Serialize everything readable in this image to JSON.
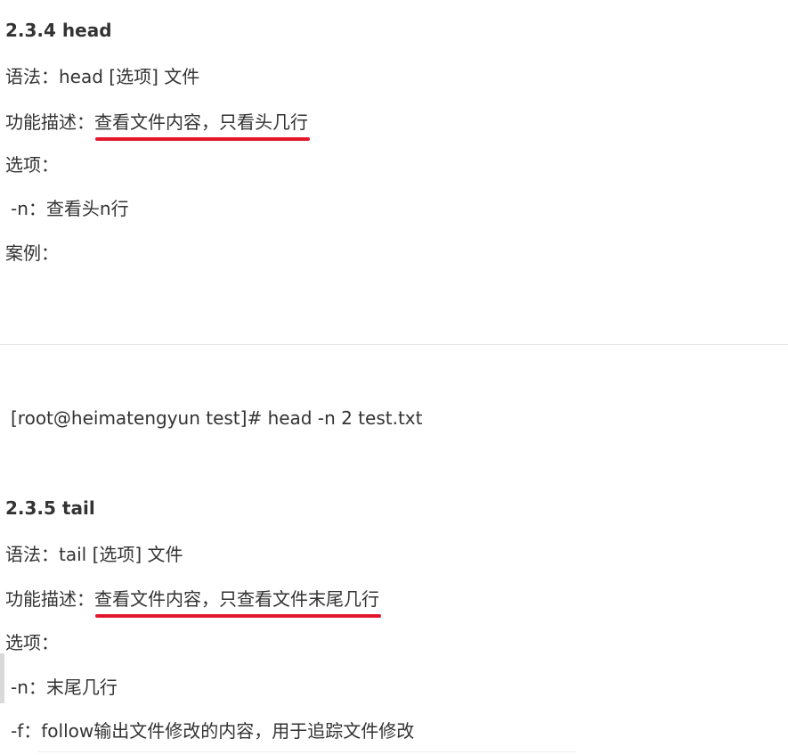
{
  "section_head": {
    "heading": "2.3.4 head",
    "syntax_label": "语法：",
    "syntax_value": "head [选项] 文件",
    "desc_label": "功能描述：",
    "desc_value": "查看文件内容，只看头几行",
    "options_label": "选项：",
    "option_n": "-n：查看头n行",
    "example_label": "案例："
  },
  "code_example": "[root@heimatengyun test]# head -n 2 test.txt",
  "section_tail": {
    "heading": "2.3.5 tail",
    "syntax_label": "语法：",
    "syntax_value": "tail [选项] 文件",
    "desc_label": "功能描述：",
    "desc_value": "查看文件内容，只查看文件末尾几行",
    "options_label": "选项：",
    "option_n": "-n：末尾几行",
    "option_f": "-f：follow输出文件修改的内容，用于追踪文件修改"
  },
  "colors": {
    "underline": "#e3172b",
    "text": "#333333"
  }
}
